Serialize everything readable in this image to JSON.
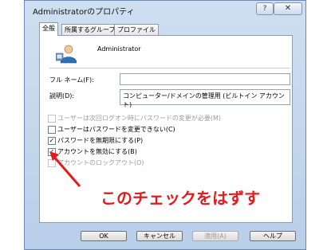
{
  "window": {
    "title": "Administratorのプロパティ",
    "help_label": "?",
    "close_label": "✕"
  },
  "tabs": [
    {
      "label": "全般"
    },
    {
      "label": "所属するグループ"
    },
    {
      "label": "プロファイル"
    }
  ],
  "user": {
    "name": "Administrator",
    "icon": "user-icon"
  },
  "fields": {
    "full_name_label": "フル ネーム(F):",
    "full_name_value": "",
    "description_label": "説明(D):",
    "description_value": "コンピューター/ドメインの管理用 (ビルトイン アカウント)"
  },
  "checkboxes": [
    {
      "label": "ユーザーは次回ログオン時にパスワードの変更が必要(M)",
      "checked": false,
      "disabled": true
    },
    {
      "label": "ユーザーはパスワードを変更できない(C)",
      "checked": false,
      "disabled": false
    },
    {
      "label": "パスワードを無期限にする(P)",
      "checked": true,
      "disabled": false
    },
    {
      "label": "アカウントを無効にする(B)",
      "checked": true,
      "disabled": false
    },
    {
      "label": "アカウントのロックアウト(O)",
      "checked": false,
      "disabled": true
    }
  ],
  "annotation": {
    "text": "このチェックをはずす",
    "color": "#e31b1b"
  },
  "buttons": {
    "ok": "OK",
    "cancel": "キャンセル",
    "apply": "適用(A)",
    "help": "ヘルプ"
  }
}
